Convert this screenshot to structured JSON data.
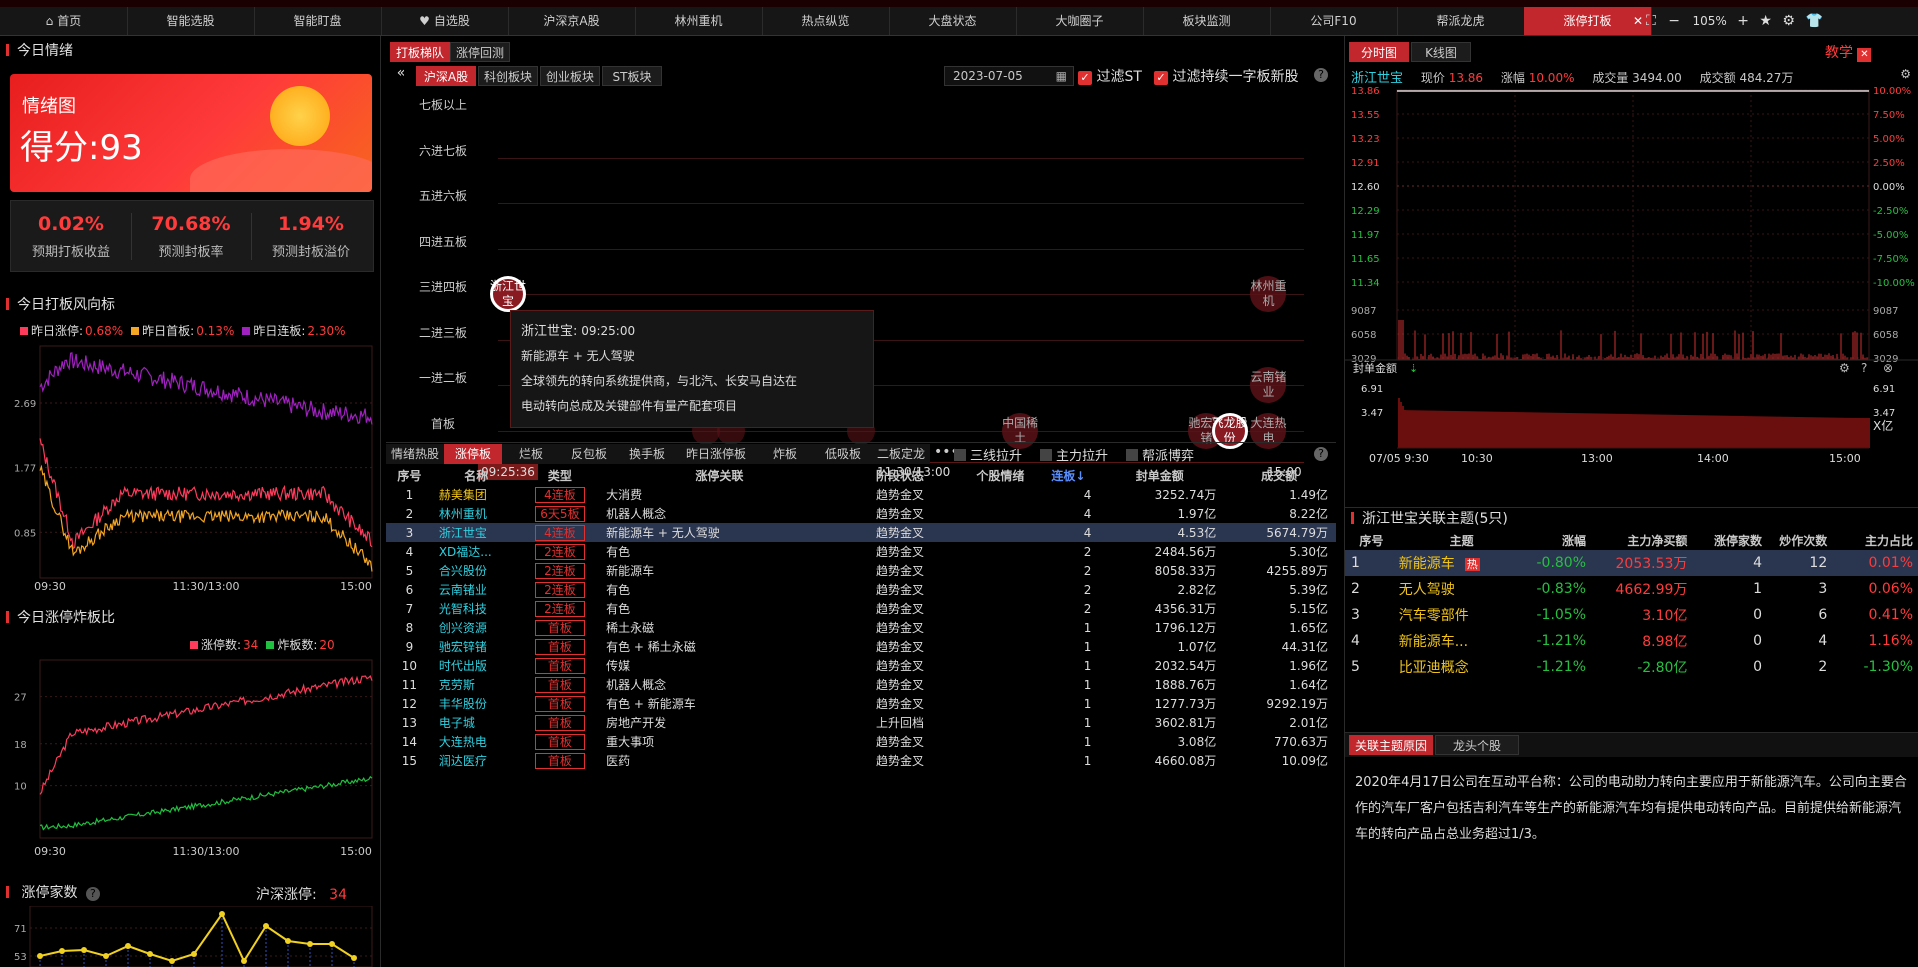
{
  "top_nav": {
    "items": [
      "首页",
      "智能选股",
      "智能盯盘",
      "自选股",
      "沪深京A股",
      "林州重机",
      "热点纵览",
      "大盘状态",
      "大咖圈子",
      "板块监测",
      "公司F10",
      "帮派龙虎",
      "涨停打板"
    ],
    "zoom": "105%"
  },
  "left": {
    "today_mood_title": "今日情绪",
    "mood_chart_label": "情绪图",
    "mood_score": "得分:93",
    "stats": [
      {
        "value": "0.02%",
        "label": "预期打板收益"
      },
      {
        "value": "70.68%",
        "label": "预测封板率"
      },
      {
        "value": "1.94%",
        "label": "预测封板溢价"
      }
    ],
    "risk_title": "今日打板风向标",
    "risk_legend": [
      {
        "name": "昨日涨停:",
        "value": "0.68%",
        "color": "#ff3b5c"
      },
      {
        "name": "昨日首板:",
        "value": "0.13%",
        "color": "#f5a623"
      },
      {
        "name": "昨日连板:",
        "value": "2.30%",
        "color": "#a020c0"
      }
    ],
    "risk_yticks": [
      "2.69",
      "1.77",
      "0.85"
    ],
    "risk_xticks": [
      "09:30",
      "11:30/13:00",
      "15:00"
    ],
    "ratio_title": "今日涨停炸板比",
    "ratio_legend": [
      {
        "name": "涨停数:",
        "value": "34",
        "color": "#ff3b5c"
      },
      {
        "name": "炸板数:",
        "value": "20",
        "color": "#20c040"
      }
    ],
    "ratio_yticks": [
      "27",
      "18",
      "10"
    ],
    "ratio_xticks": [
      "09:30",
      "11:30/13:00",
      "15:00"
    ],
    "count_title": "涨停家数",
    "count_right_label": "沪深涨停:",
    "count_right_value": "34",
    "count_yticks": [
      "71",
      "53"
    ]
  },
  "mid": {
    "tabs_top": [
      "打板梯队",
      "涨停回测"
    ],
    "market_tabs": [
      "沪深A股",
      "科创板块",
      "创业板块",
      "ST板块"
    ],
    "date": "2023-07-05",
    "filter_st": "过滤ST",
    "filter_yizi": "过滤持续一字板新股",
    "ladder_levels": [
      "七板以上",
      "六进七板",
      "五进六板",
      "四进五板",
      "三进四板",
      "二进三板",
      "一进二板",
      "首板"
    ],
    "x_labels": [
      "09:25:36",
      "11:30/13:00",
      "15:00"
    ],
    "bubbles": [
      {
        "label": "浙江世宝",
        "level": "三进四板",
        "x": 0.0
      },
      {
        "label": "林州重机",
        "level": "三进四板",
        "x": 0.98
      },
      {
        "label": "云南锗业",
        "level": "一进二板",
        "x": 0.98
      },
      {
        "label": "中国稀土",
        "level": "首板",
        "x": 0.66
      },
      {
        "label": "驰宏锌锗",
        "level": "首板",
        "x": 0.9
      },
      {
        "label": "飞龙股份",
        "level": "首板",
        "x": 0.93
      },
      {
        "label": "大连热电",
        "level": "首板",
        "x": 0.98
      }
    ],
    "tooltip": {
      "title": "浙江世宝:",
      "time": "09:25:00",
      "line1": "新能源车 + 无人驾驶",
      "line2": "全球领先的转向系统提供商，与北汽、长安马自达在",
      "line3": "电动转向总成及关键部件有量产配套项目"
    },
    "list_tabs": [
      "情绪热股",
      "涨停板",
      "烂板",
      "反包板",
      "换手板",
      "昨日涨停板",
      "炸板",
      "低吸板",
      "二板定龙"
    ],
    "checkboxes": [
      "三线拉升",
      "主力拉升",
      "帮派博弈"
    ],
    "table_headers": [
      "序号",
      "名称",
      "类型",
      "涨停关联",
      "阶段状态",
      "个股情绪",
      "连板↓",
      "封单金额",
      "成交额"
    ],
    "rows": [
      {
        "no": "1",
        "name": "赫美集团",
        "type": "4连板",
        "rel": "大消费",
        "stage": "趋势金叉",
        "mood": "",
        "lb": "4",
        "seal": "3252.74万",
        "amt": "1.49亿"
      },
      {
        "no": "2",
        "name": "林州重机",
        "type": "6天5板",
        "rel": "机器人概念",
        "stage": "趋势金叉",
        "mood": "",
        "lb": "4",
        "seal": "1.97亿",
        "amt": "8.22亿"
      },
      {
        "no": "3",
        "name": "浙江世宝",
        "type": "4连板",
        "rel": "新能源车 + 无人驾驶",
        "stage": "趋势金叉",
        "mood": "",
        "lb": "4",
        "seal": "4.53亿",
        "amt": "5674.79万"
      },
      {
        "no": "4",
        "name": "XD福达...",
        "type": "2连板",
        "rel": "有色",
        "stage": "趋势金叉",
        "mood": "",
        "lb": "2",
        "seal": "2484.56万",
        "amt": "5.30亿"
      },
      {
        "no": "5",
        "name": "合兴股份",
        "type": "2连板",
        "rel": "新能源车",
        "stage": "趋势金叉",
        "mood": "",
        "lb": "2",
        "seal": "8058.33万",
        "amt": "4255.89万"
      },
      {
        "no": "6",
        "name": "云南锗业",
        "type": "2连板",
        "rel": "有色",
        "stage": "趋势金叉",
        "mood": "",
        "lb": "2",
        "seal": "2.82亿",
        "amt": "5.39亿"
      },
      {
        "no": "7",
        "name": "光智科技",
        "type": "2连板",
        "rel": "有色",
        "stage": "趋势金叉",
        "mood": "",
        "lb": "2",
        "seal": "4356.31万",
        "amt": "5.15亿"
      },
      {
        "no": "8",
        "name": "创兴资源",
        "type": "首板",
        "rel": "稀土永磁",
        "stage": "趋势金叉",
        "mood": "",
        "lb": "1",
        "seal": "1796.12万",
        "amt": "1.65亿"
      },
      {
        "no": "9",
        "name": "驰宏锌锗",
        "type": "首板",
        "rel": "有色 + 稀土永磁",
        "stage": "趋势金叉",
        "mood": "",
        "lb": "1",
        "seal": "1.07亿",
        "amt": "44.31亿"
      },
      {
        "no": "10",
        "name": "时代出版",
        "type": "首板",
        "rel": "传媒",
        "stage": "趋势金叉",
        "mood": "",
        "lb": "1",
        "seal": "2032.54万",
        "amt": "1.96亿"
      },
      {
        "no": "11",
        "name": "克劳斯",
        "type": "首板",
        "rel": "机器人概念",
        "stage": "趋势金叉",
        "mood": "",
        "lb": "1",
        "seal": "1888.76万",
        "amt": "1.64亿"
      },
      {
        "no": "12",
        "name": "丰华股份",
        "type": "首板",
        "rel": "有色 + 新能源车",
        "stage": "趋势金叉",
        "mood": "",
        "lb": "1",
        "seal": "1277.73万",
        "amt": "9292.19万"
      },
      {
        "no": "13",
        "name": "电子城",
        "type": "首板",
        "rel": "房地产开发",
        "stage": "上升回档",
        "mood": "",
        "lb": "1",
        "seal": "3602.81万",
        "amt": "2.01亿"
      },
      {
        "no": "14",
        "name": "大连热电",
        "type": "首板",
        "rel": "重大事项",
        "stage": "趋势金叉",
        "mood": "",
        "lb": "1",
        "seal": "3.08亿",
        "amt": "770.63万"
      },
      {
        "no": "15",
        "name": "润达医疗",
        "type": "首板",
        "rel": "医药",
        "stage": "趋势金叉",
        "mood": "",
        "lb": "1",
        "seal": "4660.08万",
        "amt": "10.09亿"
      }
    ]
  },
  "right": {
    "tabs": [
      "分时图",
      "K线图"
    ],
    "teach": "教学",
    "stock": "浙江世宝",
    "price_label": "现价",
    "price": "13.86",
    "chg_label": "涨幅",
    "chg": "10.00%",
    "vol_label": "成交量",
    "vol": "3494.00",
    "amt_label": "成交额",
    "amt": "484.27万",
    "price_left": [
      "13.86",
      "13.55",
      "13.23",
      "12.91",
      "12.60",
      "12.29",
      "11.97",
      "11.65",
      "11.34",
      "9087",
      "6058",
      "3029"
    ],
    "price_right": [
      "10.00%",
      "7.50%",
      "5.00%",
      "2.50%",
      "0.00%",
      "-2.50%",
      "-5.00%",
      "-7.50%",
      "-10.00%",
      "9087",
      "6058",
      "3029"
    ],
    "seal_title": "封单金额",
    "seal_left": [
      "6.91",
      "3.47"
    ],
    "seal_right": [
      "6.91",
      "3.47",
      "X亿"
    ],
    "time_labels": [
      "07/05 9:30",
      "10:30",
      "13:00",
      "14:00",
      "15:00"
    ],
    "theme_title": "浙江世宝关联主题(5只)",
    "theme_headers": [
      "序号",
      "主题",
      "涨幅",
      "主力净买额",
      "涨停家数",
      "炒作次数",
      "主力占比"
    ],
    "themes": [
      {
        "no": "1",
        "name": "新能源车",
        "hot": "热",
        "chg": "-0.80%",
        "buy": "2053.53万",
        "zt": "4",
        "times": "12",
        "ratio": "0.01%"
      },
      {
        "no": "2",
        "name": "无人驾驶",
        "hot": "",
        "chg": "-0.83%",
        "buy": "4662.99万",
        "zt": "1",
        "times": "3",
        "ratio": "0.06%"
      },
      {
        "no": "3",
        "name": "汽车零部件",
        "hot": "",
        "chg": "-1.05%",
        "buy": "3.10亿",
        "zt": "0",
        "times": "6",
        "ratio": "0.41%"
      },
      {
        "no": "4",
        "name": "新能源车...",
        "hot": "",
        "chg": "-1.21%",
        "buy": "8.98亿",
        "zt": "0",
        "times": "4",
        "ratio": "1.16%"
      },
      {
        "no": "5",
        "name": "比亚迪概念",
        "hot": "",
        "chg": "-1.21%",
        "buy": "-2.80亿",
        "zt": "0",
        "times": "2",
        "ratio": "-1.30%"
      }
    ],
    "reason_tabs": [
      "关联主题原因",
      "龙头个股"
    ],
    "reason_text": "2020年4月17日公司在互动平台称：公司的电动助力转向主要应用于新能源汽车。公司向主要合作的汽车厂客户包括吉利汽车等生产的新能源汽车均有提供电动转向产品。目前提供给新能源汽车的转向产品占总业务超过1/3。"
  }
}
